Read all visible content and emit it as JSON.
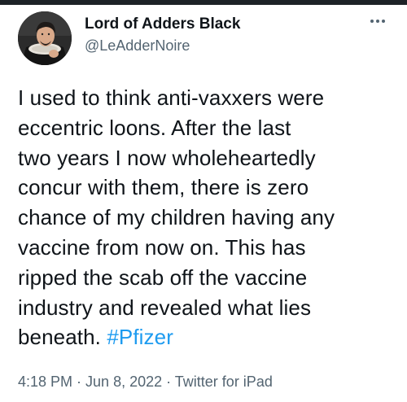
{
  "author": {
    "display_name": "Lord of Adders Black",
    "handle": "@LeAdderNoire"
  },
  "more_icon": "three-dots-horizontal",
  "tweet": {
    "lines": [
      "I used to think anti-vaxxers were",
      "eccentric loons. After the last",
      "two years I now wholeheartedly",
      "concur with them, there is zero",
      "chance of my children having any",
      "vaccine from now on. This has",
      "ripped the scab off the vaccine",
      "industry and revealed what lies"
    ],
    "last_line_prefix": "beneath. ",
    "hashtag": "#Pfizer"
  },
  "meta": {
    "time": "4:18 PM",
    "separator": " · ",
    "date": "Jun 8, 2022",
    "source": "Twitter for iPad"
  },
  "colors": {
    "text": "#0f1419",
    "secondary": "#536471",
    "link": "#1d9bf0"
  }
}
